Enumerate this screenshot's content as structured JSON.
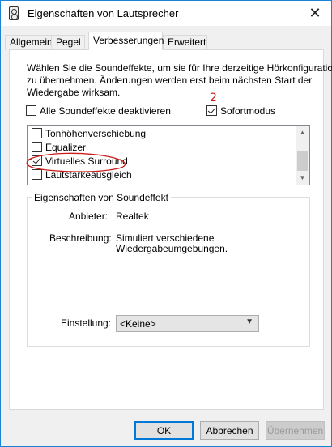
{
  "window": {
    "title": "Eigenschaften von Lautsprecher",
    "close_glyph": "✕"
  },
  "tabs": [
    {
      "label": "Allgemein"
    },
    {
      "label": "Pegel"
    },
    {
      "label": "Verbesserungen",
      "active": true
    },
    {
      "label": "Erweitert"
    }
  ],
  "intro": {
    "line1": "Wählen Sie die Soundeffekte, um sie für Ihre derzeitige Hörkonfiguration",
    "line2": "zu übernehmen. Änderungen werden erst beim nächsten Start der",
    "line3": "Wiedergabe wirksam."
  },
  "options": {
    "disable_all": {
      "label": "Alle Soundeffekte deaktivieren",
      "checked": false
    },
    "immediate": {
      "label": "Sofortmodus",
      "checked": true
    }
  },
  "effects": [
    {
      "label": "Tonhöhenverschiebung",
      "checked": false
    },
    {
      "label": "Equalizer",
      "checked": false
    },
    {
      "label": "Virtuelles Surround",
      "checked": true
    },
    {
      "label": "Lautstärkeausgleich",
      "checked": false
    }
  ],
  "properties": {
    "title": "Eigenschaften von Soundeffekt",
    "provider_label": "Anbieter:",
    "provider_value": "Realtek",
    "description_label": "Beschreibung:",
    "description_line1": "Simuliert verschiedene",
    "description_line2": "Wiedergabeumgebungen.",
    "setting_label": "Einstellung:",
    "setting_value": "<Keine>"
  },
  "buttons": {
    "ok": "OK",
    "cancel": "Abbrechen",
    "apply": "Übernehmen"
  },
  "annotation": {
    "mark": "2",
    "color": "#cc1a1a"
  },
  "colors": {
    "accent": "#0078d7",
    "window_border": "#1883d7"
  }
}
